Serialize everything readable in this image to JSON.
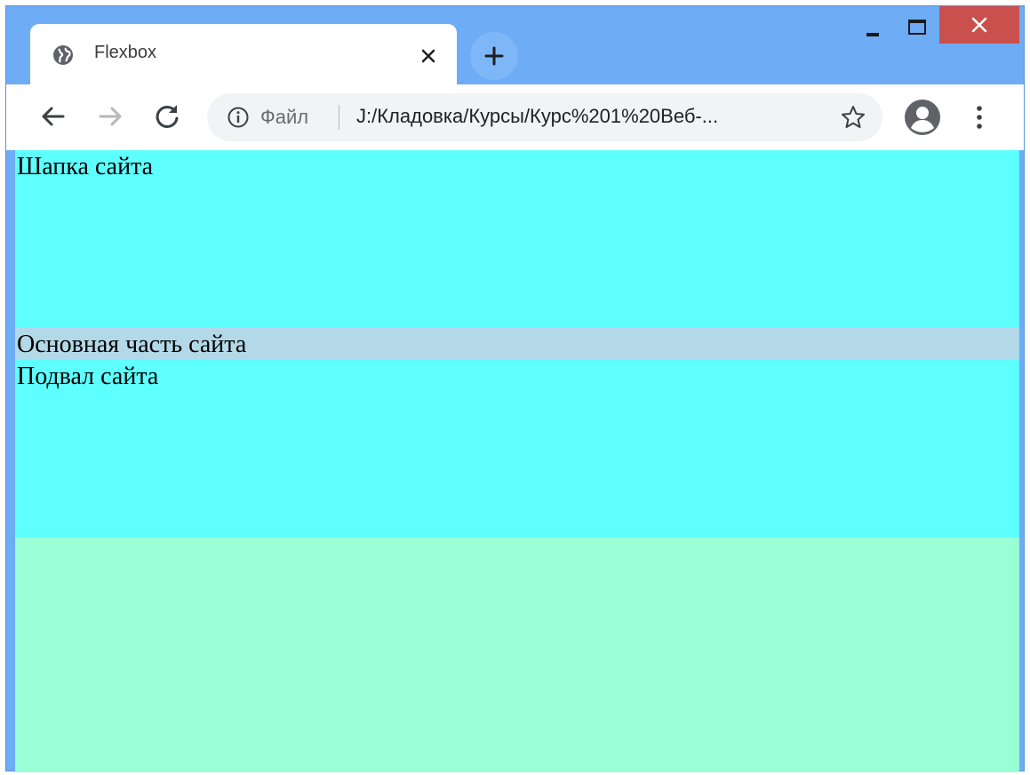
{
  "browser": {
    "tab": {
      "title": "Flexbox",
      "icon": "globe-icon"
    },
    "window_controls": [
      "minimize-icon",
      "maximize-icon",
      "close-icon"
    ],
    "colors": {
      "title_bar": "#6eacf5",
      "close_button": "#c9504c"
    }
  },
  "toolbar": {
    "omnibox": {
      "file_label": "Файл",
      "url": "J:/Кладовка/Курсы/Курс%201%20Веб-..."
    }
  },
  "page": {
    "header_text": "Шапка сайта",
    "main_text": "Основная часть сайта",
    "footer_text": "Подвал сайта",
    "colors": {
      "header_bg": "#5dffff",
      "main_bg": "#b3d9e8",
      "footer_bg": "#5dffff",
      "body_bg": "#99ffd5"
    }
  }
}
